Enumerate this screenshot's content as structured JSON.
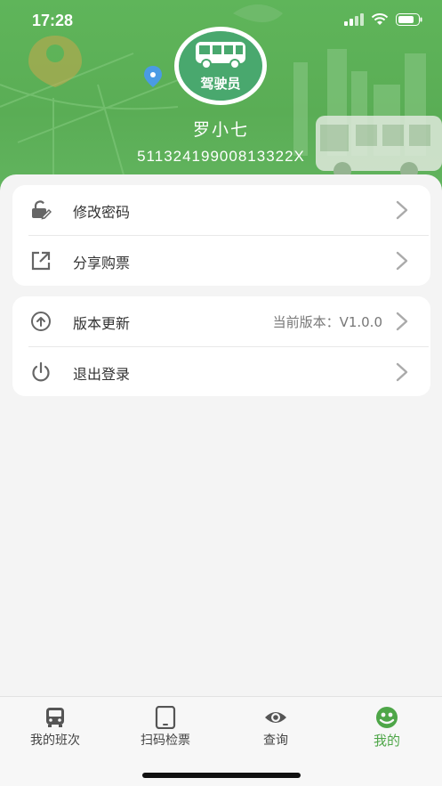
{
  "status_bar": {
    "time": "17:28",
    "icons": [
      "signal-icon",
      "wifi-icon",
      "battery-icon"
    ]
  },
  "profile": {
    "role_badge": "驾驶员",
    "name": "罗小七",
    "id_number": "51132419900813322X"
  },
  "menu_groups": [
    {
      "items": [
        {
          "label": "修改密码",
          "icon": "lock-edit-icon"
        },
        {
          "label": "分享购票",
          "icon": "share-icon"
        }
      ]
    },
    {
      "items": [
        {
          "label": "版本更新",
          "icon": "upload-icon",
          "value": "当前版本：V1.0.0"
        },
        {
          "label": "退出登录",
          "icon": "power-icon"
        }
      ]
    }
  ],
  "tabs": [
    {
      "label": "我的班次",
      "icon": "bus-icon",
      "active": false
    },
    {
      "label": "扫码检票",
      "icon": "tablet-icon",
      "active": false
    },
    {
      "label": "查询",
      "icon": "eye-icon",
      "active": false
    },
    {
      "label": "我的",
      "icon": "user-face-icon",
      "active": true
    }
  ],
  "colors": {
    "header_green": "#5aad55",
    "active_tab": "#4ea648",
    "background": "#f4f4f4"
  }
}
